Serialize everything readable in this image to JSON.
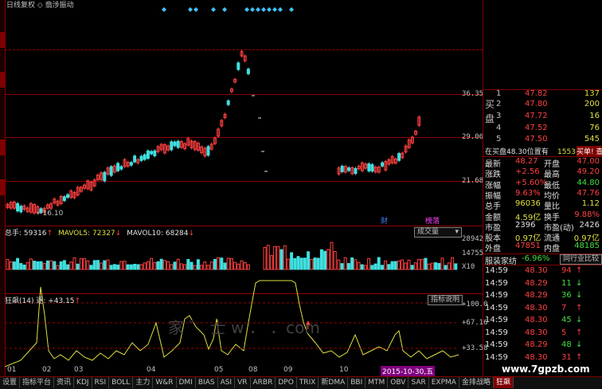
{
  "colors": {
    "up": "#ff4040",
    "down": "#40e0e0",
    "grid": "#900000",
    "line_yellow": "#e0e040"
  },
  "top_header": {
    "title": "日线复权 ◇ 翡涉振动"
  },
  "price_axis": [
    "36.35",
    "29.06",
    "21.68"
  ],
  "price_annotation": "16.10",
  "price_markers": [
    "财",
    "榜落"
  ],
  "volume_header": {
    "label": "总手: 59316",
    "ma5": "MAVOL5: 72327",
    "ma10": "MAVOL10: 68284",
    "dropdown": "成交量"
  },
  "volume_axis": [
    "28942",
    "14755",
    "X10"
  ],
  "indicator_header": {
    "label": "狂飙(14) 逐: +43.15",
    "button": "指标说明"
  },
  "indicator_axis": [
    "+100.0",
    "+67.16",
    "+33.58"
  ],
  "watermark": "家 ゛ 士   w ．   ．com",
  "date_axis": [
    "01",
    "02",
    "03",
    "04",
    "05",
    "08",
    "09",
    "10"
  ],
  "date_highlight": "2015-10-30,五",
  "orderbook": {
    "ask_label": "买",
    "bid_label": "盘",
    "rows": [
      {
        "n": "1",
        "price": "47.82",
        "vol": "137"
      },
      {
        "n": "2",
        "price": "47.80",
        "vol": "200"
      },
      {
        "n": "3",
        "price": "47.72",
        "vol": "16"
      },
      {
        "n": "4",
        "price": "47.52",
        "vol": "76"
      },
      {
        "n": "5",
        "price": "47.50",
        "vol": "545"
      }
    ],
    "status": "在买盘48.30位置有",
    "status_vol": "1553手",
    "status_btn": "买单! 查看详细"
  },
  "quote": [
    {
      "l1": "最新",
      "v1": "48.27",
      "l2": "开盘",
      "v2": "47.00"
    },
    {
      "l1": "涨跌",
      "v1": "+2.56",
      "l2": "最高",
      "v2": "49.20"
    },
    {
      "l1": "涨幅",
      "v1": "+5.60%",
      "l2": "最低",
      "v2": "44.80"
    },
    {
      "l1": "振幅",
      "v1": "9.63%",
      "l2": "均价",
      "v2": "47.76"
    },
    {
      "l1": "总手",
      "v1": "96036",
      "l2": "量比",
      "v2": "1.12"
    },
    {
      "l1": "金额",
      "v1": "4.59亿",
      "l2": "换手",
      "v2": "9.88%"
    },
    {
      "l1": "市盈",
      "v1": "2396",
      "l2": "市盈(动)",
      "v2": "2426"
    },
    {
      "l1": "股本",
      "v1": "0.97亿",
      "l2": "流通",
      "v2": "0.97亿"
    },
    {
      "l1": "外盘",
      "v1": "47851",
      "l2": "内盘",
      "v2": "48185"
    }
  ],
  "sector": {
    "name": "服装家纺",
    "pct": "-6.96%",
    "btn": "同行业比较"
  },
  "ticks": [
    {
      "t": "14:59",
      "p": "48.30",
      "v": "94",
      "d": "↑"
    },
    {
      "t": "14:59",
      "p": "48.29",
      "v": "11",
      "d": "↓"
    },
    {
      "t": "14:59",
      "p": "48.29",
      "v": "36",
      "d": "↓"
    },
    {
      "t": "14:59",
      "p": "48.30",
      "v": "7",
      "d": "↑"
    },
    {
      "t": "14:59",
      "p": "48.30",
      "v": "45",
      "d": "↓"
    },
    {
      "t": "14:59",
      "p": "48.30",
      "v": "5",
      "d": "↑"
    },
    {
      "t": "14:59",
      "p": "48.29",
      "v": "48",
      "d": "↓"
    },
    {
      "t": "14:59",
      "p": "48.30",
      "v": "31",
      "d": "↑"
    }
  ],
  "site_watermark": "www.7gpzb.com",
  "bottom_tabs": [
    "设置",
    "指标平台",
    "资讯",
    "KDJ",
    "RSI",
    "BOLL",
    "主力",
    "W&R",
    "DMI",
    "BIAS",
    "ASI",
    "VR",
    "ARBR",
    "DPO",
    "TRIX",
    "新DMA",
    "BBI",
    "MTM",
    "OBV",
    "SAR",
    "EXPMA",
    "金排战略",
    "狂飙"
  ]
}
